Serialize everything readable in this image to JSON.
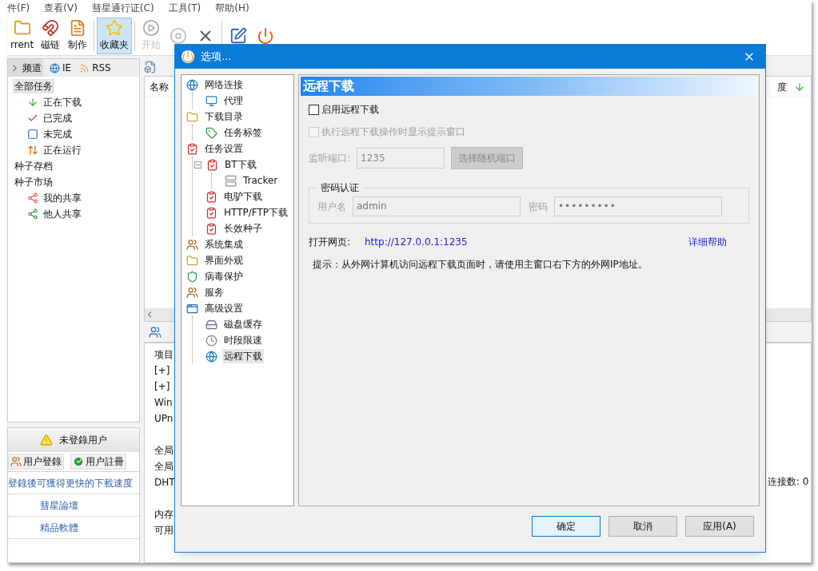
{
  "menu": [
    "件(F)",
    "查看(V)",
    "彗星通行证(C)",
    "工具(T)",
    "帮助(H)"
  ],
  "toolbar": [
    {
      "kind": "folder",
      "label": "rrent",
      "selected": false,
      "disabled": false
    },
    {
      "kind": "magnet",
      "label": "磁链",
      "selected": false,
      "disabled": false
    },
    {
      "kind": "document",
      "label": "制作",
      "selected": false,
      "disabled": false
    },
    {
      "kind": "star",
      "label": "收藏夹",
      "selected": true,
      "disabled": false
    },
    {
      "kind": "play",
      "label": "开始",
      "selected": false,
      "disabled": true
    },
    {
      "kind": "stop",
      "selected": false,
      "disabled": true
    },
    {
      "kind": "delete",
      "selected": false,
      "disabled": false
    },
    {
      "kind": "edit",
      "selected": false,
      "disabled": false
    },
    {
      "kind": "power",
      "selected": false,
      "disabled": false
    }
  ],
  "sidebar": {
    "tabs": [
      {
        "kind": "arrow",
        "label": "频道",
        "selected": true
      },
      {
        "kind": "globe",
        "label": "IE",
        "selected": false
      },
      {
        "kind": "rss",
        "label": "RSS",
        "selected": false
      }
    ],
    "items": [
      {
        "label": "全部任务",
        "selected": true,
        "children": [
          {
            "kind": "down",
            "label": "正在下载",
            "selected": false
          },
          {
            "kind": "check",
            "label": "已完成",
            "selected": false
          },
          {
            "kind": "partial",
            "label": "未完成",
            "selected": false
          },
          {
            "kind": "updown",
            "label": "正在运行",
            "selected": false
          }
        ]
      },
      {
        "label": "种子存档",
        "selected": false
      },
      {
        "label": "种子市场",
        "selected": false,
        "children": [
          {
            "kind": "share-out",
            "label": "我的共享",
            "selected": false
          },
          {
            "kind": "share-in",
            "label": "他人共享",
            "selected": false
          }
        ]
      }
    ]
  },
  "user_panel": {
    "title": "未登錄用户",
    "buttons": [
      {
        "kind": "users",
        "label": "用户登錄"
      },
      {
        "kind": "check",
        "label": "用户註冊"
      }
    ],
    "links": [
      "登錄後可獲得更快的下載速度",
      "彗星論壇",
      "精品軟體"
    ]
  },
  "table": {
    "columns": [
      "名称",
      "度"
    ]
  },
  "details": {
    "sections": [
      [
        "项目",
        "[+]",
        "[+]",
        "Win",
        "UPn"
      ],
      [
        "全局",
        "全局",
        "DHT"
      ],
      [
        "内存",
        "可用"
      ]
    ],
    "status": "连接数: 0"
  },
  "dialog": {
    "title": "选项...",
    "tree": [
      {
        "kind": "globe",
        "label": "网络连接",
        "selected": false,
        "children": [
          {
            "kind": "monitor",
            "label": "代理",
            "selected": false
          }
        ]
      },
      {
        "kind": "folder",
        "label": "下载目录",
        "selected": false,
        "children": [
          {
            "kind": "tag",
            "label": "任务标签",
            "selected": false
          }
        ]
      },
      {
        "kind": "clipboard",
        "label": "任务设置",
        "selected": false,
        "children": [
          {
            "kind": "clipboard",
            "label": "BT下载",
            "selected": false,
            "expanded": true,
            "children": [
              {
                "kind": "server",
                "label": "Tracker",
                "selected": false
              }
            ]
          },
          {
            "kind": "clipboard",
            "label": "电驴下载",
            "selected": false
          },
          {
            "kind": "clipboard",
            "label": "HTTP/FTP下载",
            "selected": false
          },
          {
            "kind": "clipboard",
            "label": "长效种子",
            "selected": false
          }
        ]
      },
      {
        "kind": "users",
        "label": "系统集成",
        "selected": false
      },
      {
        "kind": "folder",
        "label": "界面外观",
        "selected": false
      },
      {
        "kind": "shield",
        "label": "病毒保护",
        "selected": false
      },
      {
        "kind": "users",
        "label": "服务",
        "selected": false
      },
      {
        "kind": "window",
        "label": "高级设置",
        "selected": false,
        "children": [
          {
            "kind": "disk",
            "label": "磁盘缓存",
            "selected": false
          },
          {
            "kind": "clock",
            "label": "时段限速",
            "selected": false
          },
          {
            "kind": "globe",
            "label": "远程下载",
            "selected": true
          }
        ]
      }
    ],
    "panel_title": "远程下载",
    "checkboxes": [
      {
        "label": "启用远程下载",
        "checked": false,
        "disabled": false
      },
      {
        "label": "执行远程下载操作时显示提示窗口",
        "checked": false,
        "disabled": true
      }
    ],
    "port": {
      "label": "监听端口:",
      "value": "1235",
      "button": "选择随机端口",
      "disabled": true
    },
    "auth": {
      "title": "密码认证",
      "user_label": "用户名",
      "user_value": "admin",
      "pass_label": "密码",
      "pass_value": "•••••••••",
      "disabled": true
    },
    "open_label": "打开网页:",
    "url": "http://127.0.0.1:1235",
    "help": "详细帮助",
    "hint": "提示：从外网计算机访问远程下载页面时，请使用主窗口右下方的外网IP地址。",
    "buttons": [
      "确定",
      "取消",
      "应用(A)"
    ]
  }
}
